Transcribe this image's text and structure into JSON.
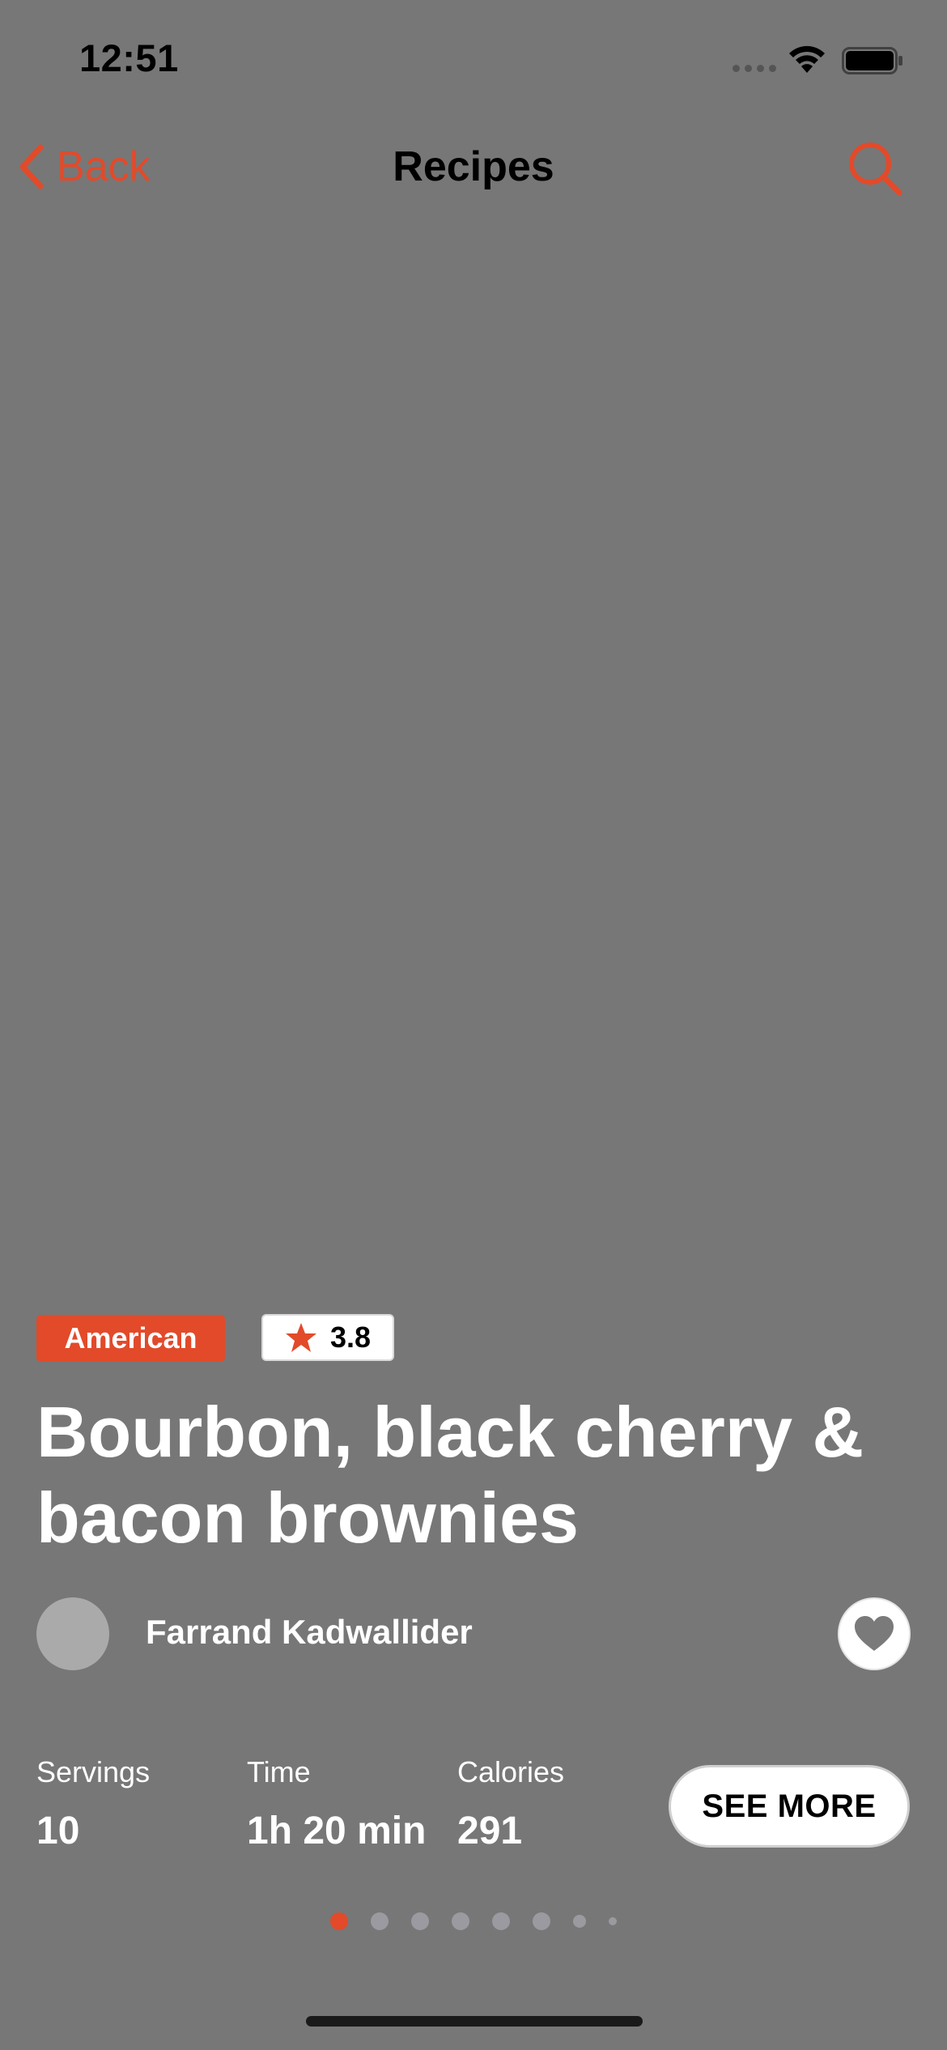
{
  "status_bar": {
    "time": "12:51"
  },
  "nav": {
    "back_label": "Back",
    "title": "Recipes",
    "icons": [
      "chevron-left-icon",
      "search-icon"
    ]
  },
  "recipe": {
    "cuisine": "American",
    "rating": "3.8",
    "title": "Bourbon, black cherry & bacon brownies",
    "author": "Farrand Kadwallider",
    "stats": {
      "servings_label": "Servings",
      "servings_value": "10",
      "time_label": "Time",
      "time_value": "1h 20 min",
      "calories_label": "Calories",
      "calories_value": "291"
    },
    "see_more_label": "SEE MORE"
  },
  "pager": {
    "total_pages": 8,
    "active_index": 0
  },
  "colors": {
    "accent": "#e24a2a",
    "background": "#777777",
    "text": "#ffffff"
  }
}
